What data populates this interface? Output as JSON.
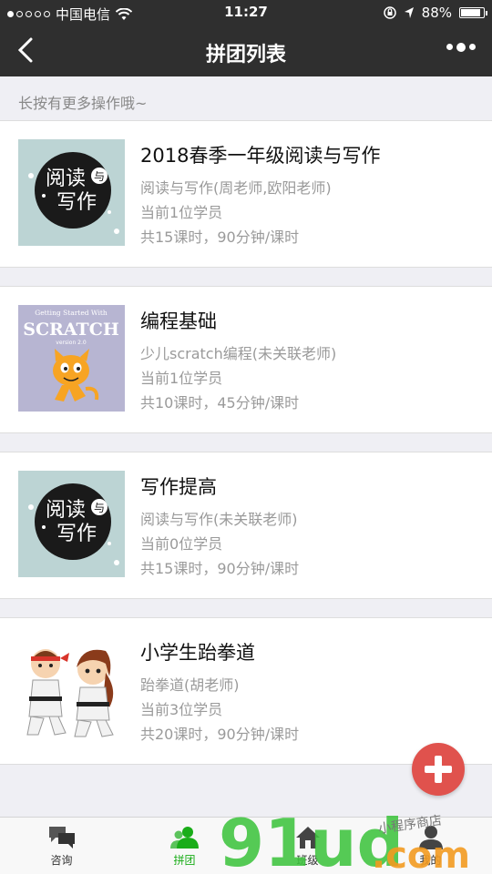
{
  "status_bar": {
    "carrier": "中国电信",
    "time": "11:27",
    "battery": "88%"
  },
  "nav": {
    "title": "拼团列表"
  },
  "hint": "长按有更多操作哦~",
  "groups": [
    {
      "title": "2018春季一年级阅读与写作",
      "subject": "阅读与写作(周老师,欧阳老师)",
      "students": "当前1位学员",
      "schedule": "共15课时，90分钟/课时",
      "thumb": "reading-writing"
    },
    {
      "title": "编程基础",
      "subject": "少儿scratch编程(未关联老师)",
      "students": "当前1位学员",
      "schedule": "共10课时，45分钟/课时",
      "thumb": "scratch"
    },
    {
      "title": "写作提高",
      "subject": "阅读与写作(未关联老师)",
      "students": "当前0位学员",
      "schedule": "共15课时，90分钟/课时",
      "thumb": "reading-writing"
    },
    {
      "title": "小学生跆拳道",
      "subject": "跆拳道(胡老师)",
      "students": "当前3位学员",
      "schedule": "共20课时，90分钟/课时",
      "thumb": "taekwondo"
    }
  ],
  "thumb_text": {
    "reading_1": "阅读",
    "reading_2": "写作",
    "reading_small": "与",
    "scratch_top": "Getting Started With",
    "scratch_main": "SCRATCH",
    "scratch_ver": "version 2.0"
  },
  "tabs": [
    {
      "label": "咨询",
      "icon": "chat-icon"
    },
    {
      "label": "拼团",
      "icon": "group-icon",
      "active": true
    },
    {
      "label": "班级",
      "icon": "home-icon"
    },
    {
      "label": "我的",
      "icon": "user-icon"
    }
  ],
  "watermark": {
    "main": "91ud",
    "domain": ".com",
    "tag": "小程序商店"
  },
  "colors": {
    "accent": "#1aad19",
    "fab": "#e0524d",
    "navbar": "#2f2f2f"
  }
}
